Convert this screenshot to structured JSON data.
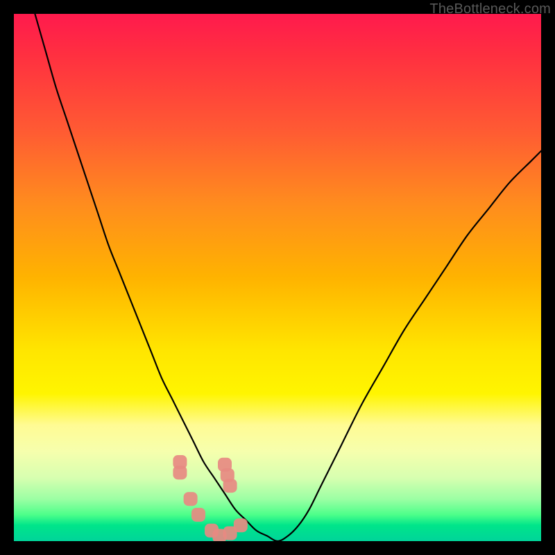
{
  "watermark": {
    "text": "TheBottleneck.com"
  },
  "chart_data": {
    "type": "line",
    "title": "",
    "xlabel": "",
    "ylabel": "",
    "xlim": [
      0,
      100
    ],
    "ylim": [
      0,
      100
    ],
    "grid": false,
    "legend": false,
    "series": [
      {
        "name": "bottleneck-curve",
        "x": [
          4,
          6,
          8,
          10,
          12,
          14,
          16,
          18,
          20,
          22,
          24,
          26,
          28,
          30,
          32,
          34,
          36,
          38,
          40,
          42,
          44,
          46,
          48,
          50,
          52,
          54,
          56,
          58,
          60,
          62,
          66,
          70,
          74,
          78,
          82,
          86,
          90,
          94,
          98,
          100
        ],
        "y": [
          100,
          93,
          86,
          80,
          74,
          68,
          62,
          56,
          51,
          46,
          41,
          36,
          31,
          27,
          23,
          19,
          15,
          12,
          9,
          6,
          4,
          2,
          1,
          0,
          1,
          3,
          6,
          10,
          14,
          18,
          26,
          33,
          40,
          46,
          52,
          58,
          63,
          68,
          72,
          74
        ]
      },
      {
        "name": "highlighted-data-points",
        "x": [
          31.5,
          31.5,
          33.5,
          35.0,
          37.5,
          39.0,
          41.0,
          43.0,
          40.5,
          41.0,
          40.0
        ],
        "y": [
          15.0,
          13.0,
          8.0,
          5.0,
          2.0,
          1.0,
          1.5,
          3.0,
          12.5,
          10.5,
          14.5
        ]
      }
    ],
    "gradient_stops": [
      {
        "pos": 0,
        "color": "#ff1a4d"
      },
      {
        "pos": 50,
        "color": "#ffe600"
      },
      {
        "pos": 100,
        "color": "#00d49a"
      }
    ]
  }
}
